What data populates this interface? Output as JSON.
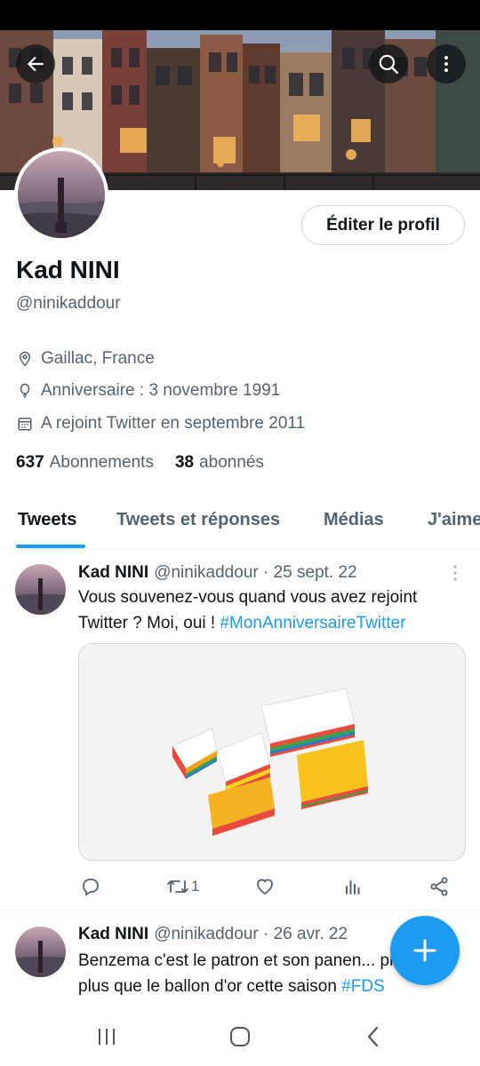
{
  "profile": {
    "display_name": "Kad NINI",
    "handle": "@ninikaddour",
    "edit_label": "Éditer le profil",
    "location": "Gaillac, France",
    "birthday": "Anniversaire : 3 novembre 1991",
    "joined": "A rejoint Twitter en septembre 2011",
    "following_count": "637",
    "following_label": "Abonnements",
    "followers_count": "38",
    "followers_label": "abonnés"
  },
  "tabs": [
    {
      "label": "Tweets",
      "active": true
    },
    {
      "label": "Tweets et réponses"
    },
    {
      "label": "Médias"
    },
    {
      "label": "J'aime"
    }
  ],
  "tweets": [
    {
      "name": "Kad NINI",
      "meta": "@ninikaddour · 25 sept. 22",
      "text": "Vous souvenez-vous quand vous avez rejoint Twitter ? Moi, oui ! ",
      "hashtag": "#MonAnniversaireTwitter",
      "retweet_count": "1"
    },
    {
      "name": "Kad NINI",
      "meta": "@ninikaddour · 26 avr. 22",
      "text": "Benzema c'est le patron et son panen... preuve de plus que le ballon d'or cette saison",
      "hashtag": "#FDS"
    }
  ],
  "icons": {
    "back": "arrow-left-icon",
    "search": "search-icon",
    "more": "more-vertical-icon",
    "location": "location-pin-icon",
    "birthday": "balloon-icon",
    "joined": "calendar-icon",
    "reply": "reply-icon",
    "retweet": "retweet-icon",
    "like": "heart-icon",
    "views": "analytics-icon",
    "share": "share-icon",
    "compose": "plus-icon"
  },
  "colors": {
    "accent": "#1d9bf0",
    "text_primary": "#0f1419",
    "text_secondary": "#536471"
  }
}
